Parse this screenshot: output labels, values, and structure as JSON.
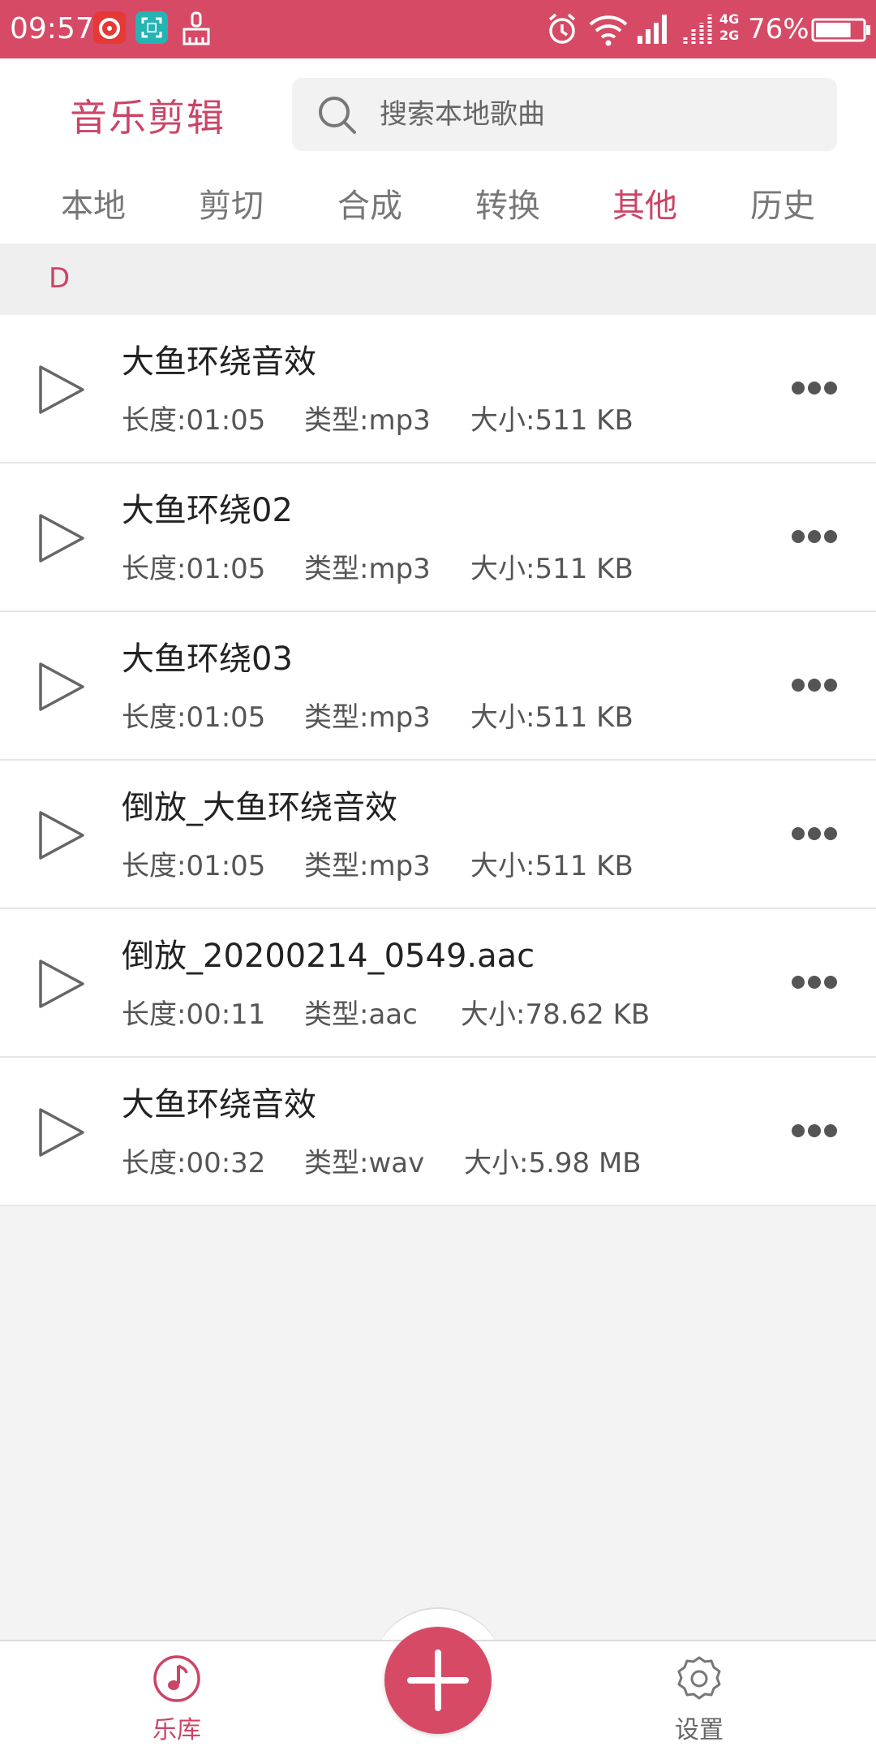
{
  "status_bar": {
    "time": "09:57",
    "network": "4G\n2G",
    "battery_percent": "76%",
    "battery_level": 0.76
  },
  "header": {
    "app_title": "音乐剪辑",
    "search_placeholder": "搜索本地歌曲"
  },
  "tabs": [
    {
      "label": "本地",
      "active": false
    },
    {
      "label": "剪切",
      "active": false
    },
    {
      "label": "合成",
      "active": false
    },
    {
      "label": "转换",
      "active": false
    },
    {
      "label": "其他",
      "active": true
    },
    {
      "label": "历史",
      "active": false
    }
  ],
  "section": {
    "letter": "D"
  },
  "songs": [
    {
      "title": "大鱼环绕音效",
      "length": "长度:01:05",
      "type": "类型:mp3",
      "size": "大小:511 KB"
    },
    {
      "title": "大鱼环绕02",
      "length": "长度:01:05",
      "type": "类型:mp3",
      "size": "大小:511 KB"
    },
    {
      "title": "大鱼环绕03",
      "length": "长度:01:05",
      "type": "类型:mp3",
      "size": "大小:511 KB"
    },
    {
      "title": "倒放_大鱼环绕音效",
      "length": "长度:01:05",
      "type": "类型:mp3",
      "size": "大小:511 KB"
    },
    {
      "title": "倒放_20200214_0549.aac",
      "length": "长度:00:11",
      "type": "类型:aac",
      "size": "大小:78.62 KB"
    },
    {
      "title": "大鱼环绕音效",
      "length": "长度:00:32",
      "type": "类型:wav",
      "size": "大小:5.98 MB"
    }
  ],
  "bottom_nav": {
    "library_label": "乐库",
    "settings_label": "设置"
  },
  "colors": {
    "accent": "#d64a66",
    "accent_text": "#cc4466"
  }
}
